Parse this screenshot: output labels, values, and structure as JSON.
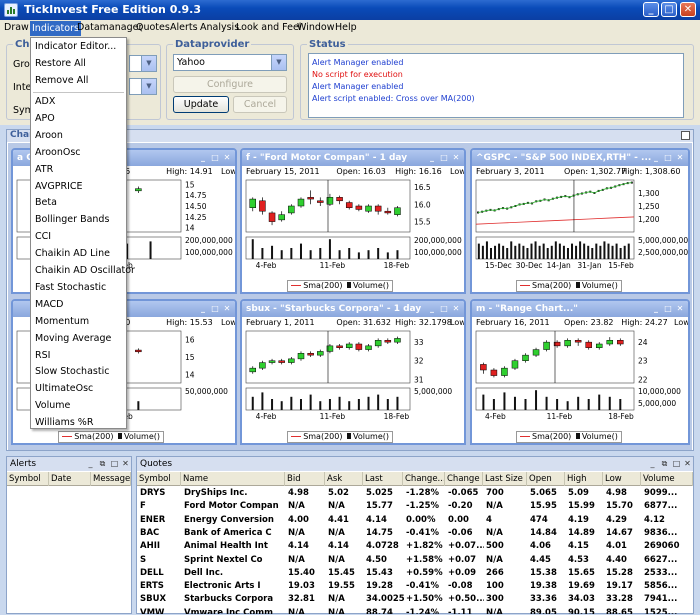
{
  "app": {
    "title": "TickInvest Free Edition 0.9.3"
  },
  "menu": [
    "Draw",
    "Indicators",
    "Datamanager",
    "Quotes",
    "Alerts",
    "Analysis",
    "Look and Feel",
    "Window",
    "Help"
  ],
  "toolbar": {
    "group_legend": "Chart",
    "group_label": "Grou",
    "interval_label": "Inte",
    "symbol_label": "Sym",
    "dataprovider_legend": "Dataprovider",
    "provider_value": "Yahoo",
    "configure_label": "Configure",
    "update_label": "Update",
    "cancel_label": "Cancel",
    "status_legend": "Status",
    "status_lines": [
      {
        "text": "Alert Manager enabled",
        "color": "#1f3fd0"
      },
      {
        "text": "No script for execution",
        "color": "#e01010"
      },
      {
        "text": "Alert Manager enabled",
        "color": "#1f3fd0"
      },
      {
        "text": "Alert script enabled: Cross over MA(200)",
        "color": "#1f3fd0"
      }
    ]
  },
  "indicators_menu": {
    "top": [
      "Indicator Editor...",
      "Restore All",
      "Remove All"
    ],
    "items": [
      "ADX",
      "APO",
      "Aroon",
      "AroonOsc",
      "ATR",
      "AVGPRICE",
      "Beta",
      "Bollinger Bands",
      "CCI",
      "Chaikin AD Line",
      "Chaikin AD Oscillator",
      "Fast Stochastic",
      "MACD",
      "Momentum",
      "Moving Average",
      "RSI",
      "Slow Stochastic",
      "UltimateOsc",
      "Volume",
      "Williams %R"
    ]
  },
  "charts_panel": {
    "title": "Char"
  },
  "charts": [
    {
      "title": "a C\" - 1 d...",
      "date": "",
      "open": "14.75",
      "high": "High: 14.91",
      "low": "Low",
      "yticks": [
        "15",
        "14.75",
        "14.50",
        "14.25",
        "14"
      ],
      "vticks": [
        "200,000,000",
        "100,000,000"
      ],
      "xticks": [
        "18-Feb"
      ],
      "legend": "Volume()",
      "candles": [
        [
          14.8,
          14.55,
          14.85,
          14.5
        ],
        [
          14.5,
          14.7,
          14.75,
          14.45
        ],
        [
          14.7,
          14.85,
          14.9,
          14.6
        ],
        [
          14.85,
          14.9,
          14.95,
          14.8
        ]
      ],
      "range": [
        13.9,
        15.1
      ],
      "volumes": [
        0.4,
        0.9,
        0.6,
        0.5,
        0.7,
        0.8
      ]
    },
    {
      "title": "f - \"Ford Motor Compan\" - 1 day",
      "date": "February 15, 2011",
      "open": "Open: 16.03",
      "high": "High: 16.16",
      "low": "Low",
      "yticks": [
        "16.5",
        "16.0",
        "15.5"
      ],
      "vticks": [
        "200,000,000",
        "100,000,000"
      ],
      "xticks": [
        "4-Feb",
        "11-Feb",
        "18-Feb"
      ],
      "legend": "Volume()",
      "sma": "Sma(200)",
      "candles": [
        [
          15.9,
          16.15,
          16.2,
          15.8
        ],
        [
          16.1,
          15.8,
          16.2,
          15.7
        ],
        [
          15.75,
          15.5,
          15.8,
          15.4
        ],
        [
          15.55,
          15.7,
          15.8,
          15.5
        ],
        [
          15.75,
          15.95,
          16.0,
          15.7
        ],
        [
          15.95,
          16.15,
          16.2,
          15.9
        ],
        [
          16.2,
          16.15,
          16.4,
          16.0
        ],
        [
          16.1,
          16.05,
          16.2,
          15.95
        ],
        [
          16.0,
          16.2,
          16.3,
          15.95
        ],
        [
          16.2,
          16.1,
          16.25,
          16.0
        ],
        [
          16.05,
          15.9,
          16.1,
          15.85
        ],
        [
          15.95,
          15.85,
          16.0,
          15.8
        ],
        [
          15.8,
          15.95,
          16.0,
          15.75
        ],
        [
          15.95,
          15.8,
          16.0,
          15.7
        ],
        [
          15.8,
          15.75,
          15.9,
          15.7
        ],
        [
          15.7,
          15.9,
          15.95,
          15.65
        ]
      ],
      "range": [
        15.2,
        16.7
      ],
      "volumes": [
        0.9,
        0.5,
        0.6,
        0.4,
        0.5,
        0.7,
        0.4,
        0.5,
        0.9,
        0.4,
        0.5,
        0.3,
        0.4,
        0.5,
        0.3,
        0.4
      ]
    },
    {
      "title": "^GSPC - \"S&P 500 INDEX,RTH\" - ...",
      "date": "February 3, 2011",
      "open": "Open: 1,302.77",
      "high": "High: 1,308.60",
      "low": "",
      "yticks": [
        "1,300",
        "1,250",
        "1,200"
      ],
      "vticks": [
        "5,000,000,000",
        "2,500,000,000"
      ],
      "xticks": [
        "15-Dec",
        "30-Dec",
        "14-Jan",
        "31-Jan",
        "15-Feb"
      ],
      "legend": "Volume()",
      "sma": "Sma(200)",
      "trend": [
        1225,
        1228,
        1232,
        1235,
        1233,
        1238,
        1242,
        1240,
        1245,
        1250,
        1256,
        1258,
        1262,
        1260,
        1268,
        1270,
        1275,
        1272,
        1278,
        1282,
        1285,
        1288,
        1284,
        1290,
        1295,
        1298,
        1302,
        1305,
        1300,
        1308,
        1312,
        1318,
        1320,
        1325,
        1330,
        1334,
        1338,
        1340
      ],
      "smatrend": [
        1180,
        1184,
        1188,
        1192,
        1196,
        1200,
        1204,
        1208
      ],
      "range": [
        1150,
        1350
      ],
      "volumes": [
        0.7,
        0.6,
        0.8,
        0.5,
        0.6,
        0.7,
        0.6,
        0.5,
        0.8,
        0.6,
        0.7,
        0.6,
        0.5,
        0.7,
        0.8,
        0.6,
        0.7,
        0.5,
        0.6,
        0.8,
        0.7,
        0.6,
        0.5,
        0.7,
        0.6,
        0.8,
        0.7,
        0.6,
        0.5,
        0.7,
        0.6,
        0.8,
        0.7,
        0.6,
        0.7,
        0.5,
        0.6,
        0.7
      ]
    },
    {
      "title": "",
      "date": "",
      "open": "15.40",
      "high": "High: 15.53",
      "low": "Low",
      "yticks": [
        "16",
        "15",
        "14"
      ],
      "vticks": [
        "50,000,000"
      ],
      "xticks": [
        "18-Feb"
      ],
      "legend": "Volume()",
      "sma": "Sma(200)",
      "candles": [
        [
          14.0,
          14.5,
          14.6,
          13.8
        ],
        [
          14.5,
          15.0,
          15.2,
          14.4
        ],
        [
          15.0,
          15.4,
          15.5,
          14.9
        ],
        [
          15.4,
          15.3,
          15.5,
          15.2
        ]
      ],
      "range": [
        13.5,
        16.5
      ],
      "volumes": [
        0.8,
        0.5,
        0.6,
        0.4
      ]
    },
    {
      "title": "sbux - \"Starbucks Corpora\" - 1 day",
      "date": "February 1, 2011",
      "open": "Open: 31.632",
      "high": "High: 32.1798",
      "low": "Low",
      "yticks": [
        "33",
        "32",
        "31"
      ],
      "vticks": [
        "5,000,000"
      ],
      "xticks": [
        "4-Feb",
        "11-Feb",
        "18-Feb"
      ],
      "legend": "Volume()",
      "sma": "Sma(200)",
      "candles": [
        [
          31.4,
          31.6,
          31.7,
          31.3
        ],
        [
          31.6,
          31.9,
          32.0,
          31.5
        ],
        [
          31.9,
          32.0,
          32.1,
          31.8
        ],
        [
          32.0,
          31.9,
          32.1,
          31.8
        ],
        [
          31.9,
          32.1,
          32.2,
          31.8
        ],
        [
          32.1,
          32.4,
          32.5,
          32.0
        ],
        [
          32.4,
          32.3,
          32.5,
          32.2
        ],
        [
          32.3,
          32.5,
          32.6,
          32.2
        ],
        [
          32.5,
          32.8,
          32.9,
          32.4
        ],
        [
          32.8,
          32.7,
          32.9,
          32.6
        ],
        [
          32.7,
          32.9,
          33.0,
          32.6
        ],
        [
          32.9,
          32.6,
          33.0,
          32.5
        ],
        [
          32.6,
          32.8,
          32.9,
          32.5
        ],
        [
          32.8,
          33.1,
          33.2,
          32.7
        ],
        [
          33.1,
          33.0,
          33.2,
          32.9
        ],
        [
          33.0,
          33.2,
          33.3,
          32.9
        ]
      ],
      "range": [
        30.8,
        33.6
      ],
      "volumes": [
        0.6,
        0.8,
        0.5,
        0.4,
        0.6,
        0.5,
        0.7,
        0.4,
        0.5,
        0.6,
        0.4,
        0.5,
        0.6,
        0.7,
        0.5,
        0.6
      ]
    },
    {
      "title": "m - \"Range Chart...\"",
      "date": "February 16, 2011",
      "open": "Open: 23.82",
      "high": "High: 24.27",
      "low": "Low",
      "yticks": [
        "24",
        "23",
        "22"
      ],
      "vticks": [
        "10,000,000",
        "5,000,000"
      ],
      "xticks": [
        "4-Feb",
        "11-Feb",
        "18-Feb"
      ],
      "legend": "Volume()",
      "sma": "Sma(200)",
      "candles": [
        [
          22.8,
          22.5,
          22.9,
          22.3
        ],
        [
          22.5,
          22.2,
          22.6,
          22.1
        ],
        [
          22.2,
          22.6,
          22.7,
          22.1
        ],
        [
          22.6,
          23.0,
          23.1,
          22.5
        ],
        [
          23.0,
          23.3,
          23.4,
          22.9
        ],
        [
          23.3,
          23.6,
          23.7,
          23.2
        ],
        [
          23.6,
          24.0,
          24.1,
          23.5
        ],
        [
          24.0,
          23.8,
          24.1,
          23.7
        ],
        [
          23.8,
          24.1,
          24.2,
          23.7
        ],
        [
          24.1,
          24.0,
          24.2,
          23.8
        ],
        [
          24.0,
          23.7,
          24.1,
          23.6
        ],
        [
          23.7,
          23.9,
          24.0,
          23.6
        ],
        [
          23.9,
          24.1,
          24.27,
          23.8
        ],
        [
          24.1,
          23.9,
          24.2,
          23.8
        ]
      ],
      "range": [
        21.8,
        24.6
      ],
      "volumes": [
        0.7,
        0.5,
        0.8,
        0.6,
        0.5,
        0.9,
        0.6,
        0.5,
        0.4,
        0.6,
        0.5,
        0.7,
        0.6,
        0.5
      ]
    }
  ],
  "alerts": {
    "title": "Alerts",
    "columns": [
      "Symbol",
      "Date",
      "Message"
    ]
  },
  "quotes": {
    "title": "Quotes",
    "columns": [
      "Symbol",
      "Name",
      "Bid",
      "Ask",
      "Last",
      "Change...",
      "Change",
      "Last Size",
      "Open",
      "High",
      "Low",
      "Volume"
    ],
    "rows": [
      [
        "DRYS",
        "DryShips Inc.",
        "4.98",
        "5.02",
        "5.025",
        "-1.28%",
        "-0.065",
        "700",
        "5.065",
        "5.09",
        "4.98",
        "9099..."
      ],
      [
        "F",
        "Ford Motor Compan",
        "N/A",
        "N/A",
        "15.77",
        "-1.25%",
        "-0.20",
        "N/A",
        "15.95",
        "15.99",
        "15.70",
        "6877..."
      ],
      [
        "ENER",
        "Energy Conversion",
        "4.00",
        "4.41",
        "4.14",
        "0.00%",
        "0.00",
        "4",
        "474",
        "4.19",
        "4.29",
        "4.12"
      ],
      [
        "BAC",
        "Bank of America C",
        "N/A",
        "N/A",
        "14.75",
        "-0.41%",
        "-0.06",
        "N/A",
        "14.84",
        "14.89",
        "14.67",
        "9836..."
      ],
      [
        "AHII",
        "Animal Health Int",
        "4.14",
        "4.14",
        "4.0728",
        "+1.82%",
        "+0.07...",
        "500",
        "4.06",
        "4.15",
        "4.01",
        "269060"
      ],
      [
        "S",
        "Sprint  Nextel Co",
        "N/A",
        "N/A",
        "4.50",
        "+1.58%",
        "+0.07",
        "N/A",
        "4.45",
        "4.53",
        "4.40",
        "6627..."
      ],
      [
        "DELL",
        "Dell Inc.",
        "15.40",
        "15.45",
        "15.43",
        "+0.59%",
        "+0.09",
        "266",
        "15.38",
        "15.65",
        "15.28",
        "2533..."
      ],
      [
        "ERTS",
        "Electronic Arts I",
        "19.03",
        "19.55",
        "19.28",
        "-0.41%",
        "-0.08",
        "100",
        "19.38",
        "19.69",
        "19.17",
        "5856..."
      ],
      [
        "SBUX",
        "Starbucks Corpora",
        "32.81",
        "N/A",
        "34.0025",
        "+1.50%",
        "+0.50...",
        "300",
        "33.36",
        "34.03",
        "33.28",
        "7941..."
      ],
      [
        "VMW",
        "Vmware  Inc  Comm",
        "N/A",
        "N/A",
        "88.74",
        "-1.24%",
        "-1.11",
        "N/A",
        "89.05",
        "90.15",
        "88.65",
        "1525..."
      ]
    ]
  }
}
